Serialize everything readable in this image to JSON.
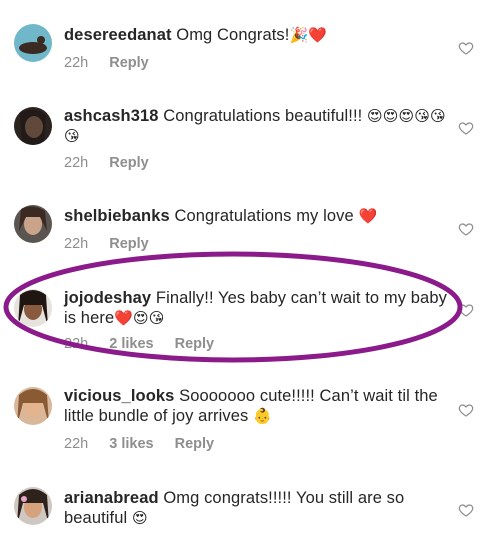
{
  "comments": [
    {
      "username": "desereedanat",
      "text": "Omg Congrats!",
      "emoji": "🎉❤️",
      "time": "22h",
      "likes": "",
      "reply": "Reply"
    },
    {
      "username": "ashcash318",
      "text": "Congratulations beautiful!!!",
      "emoji": "😍😍😍😘😘😘",
      "time": "22h",
      "likes": "",
      "reply": "Reply"
    },
    {
      "username": "shelbiebanks",
      "text": "Congratulations my love",
      "emoji": "❤️",
      "time": "22h",
      "likes": "",
      "reply": "Reply"
    },
    {
      "username": "jojodeshay",
      "text": "Finally!! Yes baby can’t wait to my baby is here",
      "emoji": "❤️😍😘",
      "time": "22h",
      "likes": "2 likes",
      "reply": "Reply"
    },
    {
      "username": "vicious_looks",
      "text": "Sooooooo cute!!!!! Can’t wait til the little bundle of joy arrives",
      "emoji": "👶",
      "time": "22h",
      "likes": "3 likes",
      "reply": "Reply"
    },
    {
      "username": "arianabread",
      "text": "Omg congrats!!!!! You still are so beautiful",
      "emoji": "😍",
      "time": "",
      "likes": "",
      "reply": ""
    }
  ],
  "icons": {
    "avatar": "avatar",
    "like": "heart-outline-icon"
  },
  "colors": {
    "highlight": "#8b1a8b",
    "meta": "#8e8e8e",
    "text": "#262626"
  }
}
